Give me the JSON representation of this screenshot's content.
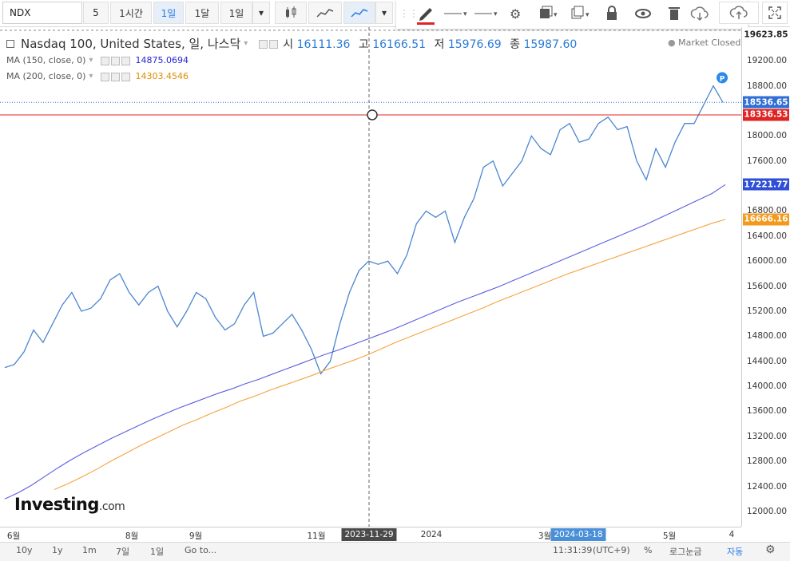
{
  "toolbar": {
    "symbol": "NDX",
    "intervals": [
      "5",
      "1시간",
      "1일",
      "1달",
      "1일"
    ],
    "active_interval_index": 2
  },
  "legend": {
    "title": "Nasdaq 100, United States, 일, 나스닥",
    "open_label": "시",
    "open": "16111.36",
    "high_label": "고",
    "high": "16166.51",
    "low_label": "저",
    "low": "15976.69",
    "close_label": "종",
    "close": "15987.60",
    "market_status": "Market Closed",
    "ma150_label": "MA (150, close, 0)",
    "ma150_value": "14875.0694",
    "ma200_label": "MA (200, close, 0)",
    "ma200_value": "14303.4546"
  },
  "price_axis": {
    "ticks": [
      "19200.00",
      "18800.00",
      "18000.00",
      "17600.00",
      "16800.00",
      "16400.00",
      "16000.00",
      "15600.00",
      "15200.00",
      "14800.00",
      "14400.00",
      "14000.00",
      "13600.00",
      "13200.00",
      "12800.00",
      "12400.00",
      "12000.00"
    ],
    "tags": {
      "top": "19623.85",
      "last": "18536.65",
      "crosshair": "18336.53",
      "ma150": "17221.77",
      "ma200": "16666.16"
    }
  },
  "time_axis": {
    "labels": [
      "6월",
      "8월",
      "9월",
      "11월",
      "2024",
      "3월",
      "5월",
      "4"
    ],
    "crosshair_date": "2023-11-29",
    "marker_date": "2024-03-18"
  },
  "watermark": {
    "brand": "Investing",
    "suffix": ".com"
  },
  "bottombar": {
    "ranges": [
      "10y",
      "1y",
      "1m",
      "7일",
      "1일",
      "Go to..."
    ],
    "time": "11:31:39",
    "tz": "(UTC+9)",
    "percent": "%",
    "log": "로그눈금",
    "auto": "자동"
  },
  "colors": {
    "price_line": "#4a86d0",
    "ma150": "#5b5ee0",
    "ma200": "#f4a33d",
    "crosshair_tag": "#e02424",
    "last_tag": "#2f6fd6",
    "ma150_tag": "#2f4fd6",
    "ma200_tag": "#f39a1c"
  },
  "chart_data": {
    "type": "line",
    "x_start": "2023-05",
    "x_end": "2024-06",
    "y_range": [
      11800,
      19700
    ],
    "series": [
      {
        "name": "Nasdaq 100",
        "values": [
          14300,
          14350,
          14550,
          14900,
          14700,
          15000,
          15300,
          15500,
          15200,
          15250,
          15400,
          15700,
          15800,
          15500,
          15300,
          15500,
          15600,
          15200,
          14950,
          15200,
          15500,
          15400,
          15100,
          14900,
          15000,
          15300,
          15500,
          14800,
          14850,
          15000,
          15150,
          14900,
          14600,
          14200,
          14400,
          15000,
          15500,
          15850,
          16000,
          15950,
          16000,
          15800,
          16100,
          16600,
          16800,
          16700,
          16800,
          16300,
          16700,
          17000,
          17500,
          17600,
          17200,
          17400,
          17600,
          18000,
          17800,
          17700,
          18100,
          18200,
          17900,
          17950,
          18200,
          18300,
          18100,
          18150,
          17600,
          17300,
          17800,
          17500,
          17900,
          18200,
          18200,
          18500,
          18800,
          18536.65
        ]
      },
      {
        "name": "MA (150, close, 0)",
        "values": [
          12200,
          12300,
          12420,
          12560,
          12700,
          12830,
          12950,
          13060,
          13170,
          13270,
          13370,
          13470,
          13560,
          13650,
          13730,
          13810,
          13890,
          13960,
          14040,
          14110,
          14190,
          14270,
          14350,
          14430,
          14510,
          14580,
          14660,
          14740,
          14820,
          14900,
          14990,
          15080,
          15170,
          15260,
          15350,
          15430,
          15510,
          15590,
          15680,
          15770,
          15860,
          15950,
          16040,
          16130,
          16220,
          16310,
          16400,
          16490,
          16580,
          16680,
          16780,
          16880,
          16980,
          17080,
          17221.77
        ]
      },
      {
        "name": "MA (200, close, 0)",
        "values": [
          12350,
          12450,
          12560,
          12680,
          12810,
          12930,
          13050,
          13160,
          13270,
          13380,
          13470,
          13570,
          13660,
          13760,
          13840,
          13930,
          14010,
          14090,
          14170,
          14260,
          14340,
          14420,
          14510,
          14610,
          14710,
          14800,
          14890,
          14980,
          15070,
          15160,
          15250,
          15350,
          15440,
          15530,
          15620,
          15710,
          15800,
          15880,
          15960,
          16040,
          16120,
          16200,
          16280,
          16360,
          16440,
          16520,
          16600,
          16666.16
        ]
      }
    ]
  }
}
